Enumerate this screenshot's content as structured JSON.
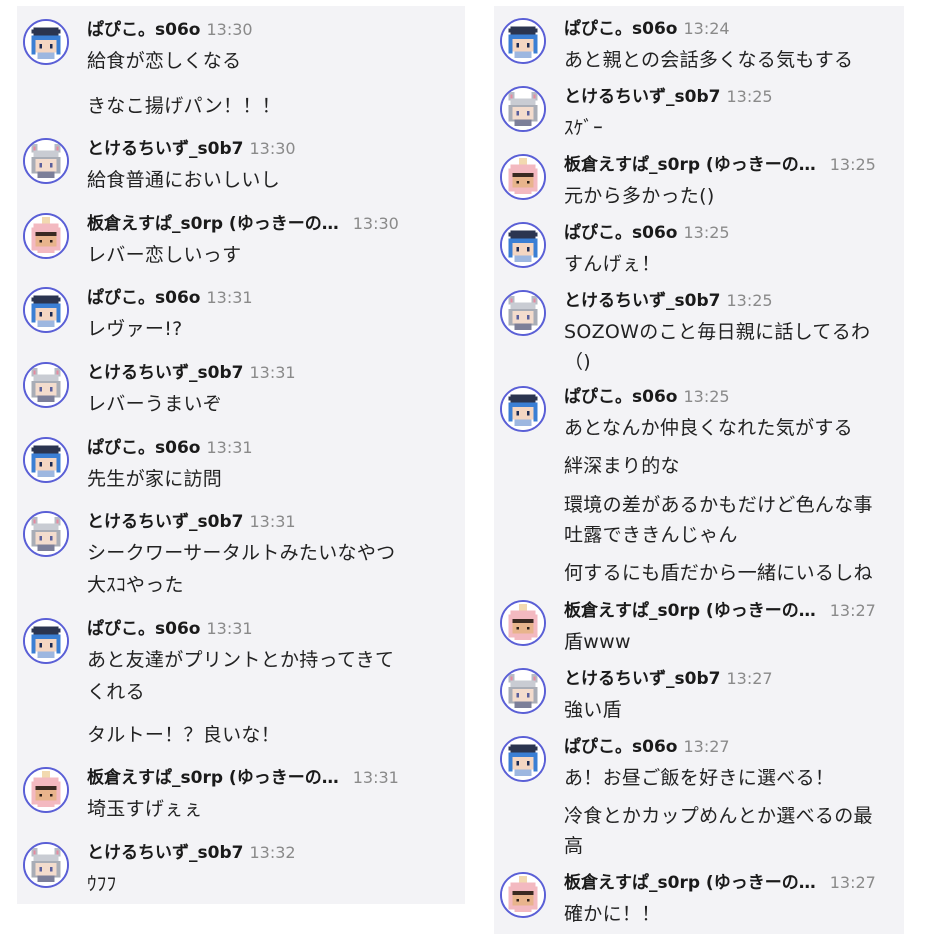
{
  "left": {
    "messages": [
      {
        "user": "ぱぴこ。s06o",
        "time": "13:30",
        "lines": [
          "給食が恋しくなる",
          "きなこ揚げパン！！！"
        ]
      },
      {
        "user": "とけるちいず_s0b7",
        "time": "13:30",
        "lines": [
          "給食普通においしいし"
        ]
      },
      {
        "user": "板倉えすぱ_s0rp (ゆっきーの…",
        "time": "13:30",
        "lines": [
          "レバー恋しいっす"
        ]
      },
      {
        "user": "ぱぴこ。s06o",
        "time": "13:31",
        "lines": [
          "レヴァー!?"
        ]
      },
      {
        "user": "とけるちいず_s0b7",
        "time": "13:31",
        "lines": [
          "レバーうまいぞ"
        ]
      },
      {
        "user": "ぱぴこ。s06o",
        "time": "13:31",
        "lines": [
          "先生が家に訪問"
        ]
      },
      {
        "user": "とけるちいず_s0b7",
        "time": "13:31",
        "lines": [
          "シークワーサータルトみたいなやつ",
          "大ｽｺやった"
        ]
      },
      {
        "user": "ぱぴこ。s06o",
        "time": "13:31",
        "lines": [
          "あと友達がプリントとか持ってきて",
          "くれる",
          "タルトー！？良いな！"
        ]
      },
      {
        "user": "板倉えすぱ_s0rp (ゆっきーの…",
        "time": "13:31",
        "lines": [
          "埼玉すげぇぇ"
        ]
      },
      {
        "user": "とけるちいず_s0b7",
        "time": "13:32",
        "lines": [
          "ｳﾌﾌ"
        ]
      }
    ]
  },
  "right": {
    "messages": [
      {
        "user": "ぱぴこ。s06o",
        "time": "13:24",
        "lines": [
          "あと親との会話多くなる気もする"
        ]
      },
      {
        "user": "とけるちいず_s0b7",
        "time": "13:25",
        "lines": [
          "ｽｹﾞｰ"
        ]
      },
      {
        "user": "板倉えすぱ_s0rp (ゆっきーの…",
        "time": "13:25",
        "lines": [
          "元から多かった()"
        ]
      },
      {
        "user": "ぱぴこ。s06o",
        "time": "13:25",
        "lines": [
          "すんげぇ！"
        ]
      },
      {
        "user": "とけるちいず_s0b7",
        "time": "13:25",
        "lines": [
          "SOZOWのこと毎日親に話してるわ",
          "（)"
        ]
      },
      {
        "user": "ぱぴこ。s06o",
        "time": "13:25",
        "lines": [
          "あとなんか仲良くなれた気がする",
          "絆深まり的な",
          "環境の差があるかもだけど色んな事",
          "吐露でききんじゃん",
          "何するにも盾だから一緒にいるしね"
        ]
      },
      {
        "user": "板倉えすぱ_s0rp (ゆっきーの…",
        "time": "13:27",
        "lines": [
          "盾www"
        ]
      },
      {
        "user": "とけるちいず_s0b7",
        "time": "13:27",
        "lines": [
          "強い盾"
        ]
      },
      {
        "user": "ぱぴこ。s06o",
        "time": "13:27",
        "lines": [
          "あ！お昼ご飯を好きに選べる！",
          "冷食とかカップめんとか選べるの最",
          "高"
        ]
      },
      {
        "user": "板倉えすぱ_s0rp (ゆっきーの…",
        "time": "13:27",
        "lines": [
          "確かに！！"
        ]
      }
    ]
  }
}
